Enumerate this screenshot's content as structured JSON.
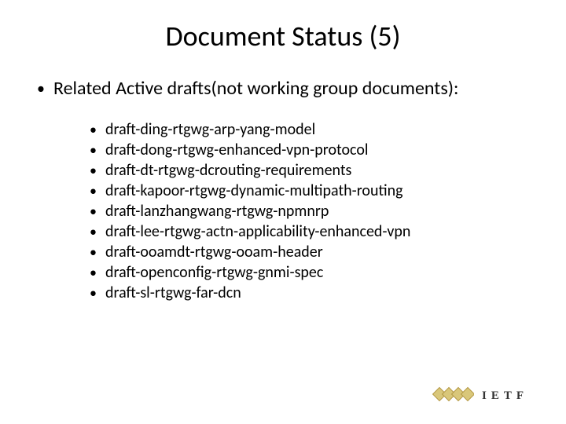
{
  "title": "Document Status (5)",
  "level1_text": "Related Active drafts(not working group documents):",
  "level2_items": [
    "draft-ding-rtgwg-arp-yang-model",
    "draft-dong-rtgwg-enhanced-vpn-protocol",
    "draft-dt-rtgwg-dcrouting-requirements",
    "draft-kapoor-rtgwg-dynamic-multipath-routing",
    "draft-lanzhangwang-rtgwg-npmnrp",
    "draft-lee-rtgwg-actn-applicability-enhanced-vpn",
    "draft-ooamdt-rtgwg-ooam-header",
    "draft-openconfig-rtgwg-gnmi-spec",
    "draft-sl-rtgwg-far-dcn"
  ],
  "logo_text": "IETF"
}
